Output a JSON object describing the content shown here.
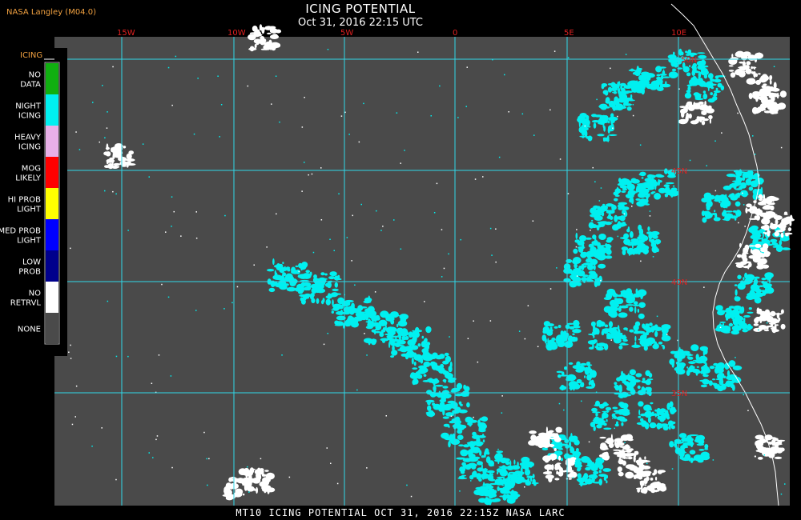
{
  "header": {
    "credit": "NASA Langley (M04.0)",
    "title": "ICING POTENTIAL",
    "subtitle": "Oct 31, 2016 22:15 UTC"
  },
  "map": {
    "lon_labels": [
      "15W",
      "10W",
      "5W",
      "0",
      "5E",
      "10E"
    ],
    "lat_labels": [
      "50N",
      "45N",
      "40N",
      "35N"
    ],
    "background_color": "#4a4a4a",
    "grid_color": "#30d8e8"
  },
  "legend": {
    "title": "ICING",
    "items": [
      {
        "label": "NO DATA",
        "color": "#10b010"
      },
      {
        "label": "NIGHT ICING",
        "color": "#00f0f0"
      },
      {
        "label": "HEAVY ICING",
        "color": "#e8b0e8"
      },
      {
        "label": "MOG LIKELY",
        "color": "#ff0000"
      },
      {
        "label": "HI PROB LIGHT",
        "color": "#ffff00"
      },
      {
        "label": "MED PROB LIGHT",
        "color": "#0000ff"
      },
      {
        "label": "LOW PROB",
        "color": "#00008c"
      },
      {
        "label": "NO RETRVL",
        "color": "#ffffff"
      },
      {
        "label": "NONE",
        "color": "#4a4a4a"
      }
    ]
  },
  "footer": {
    "text": "MT10  ICING POTENTIAL  OCT 31, 2016 22:15Z  NASA LARC"
  }
}
